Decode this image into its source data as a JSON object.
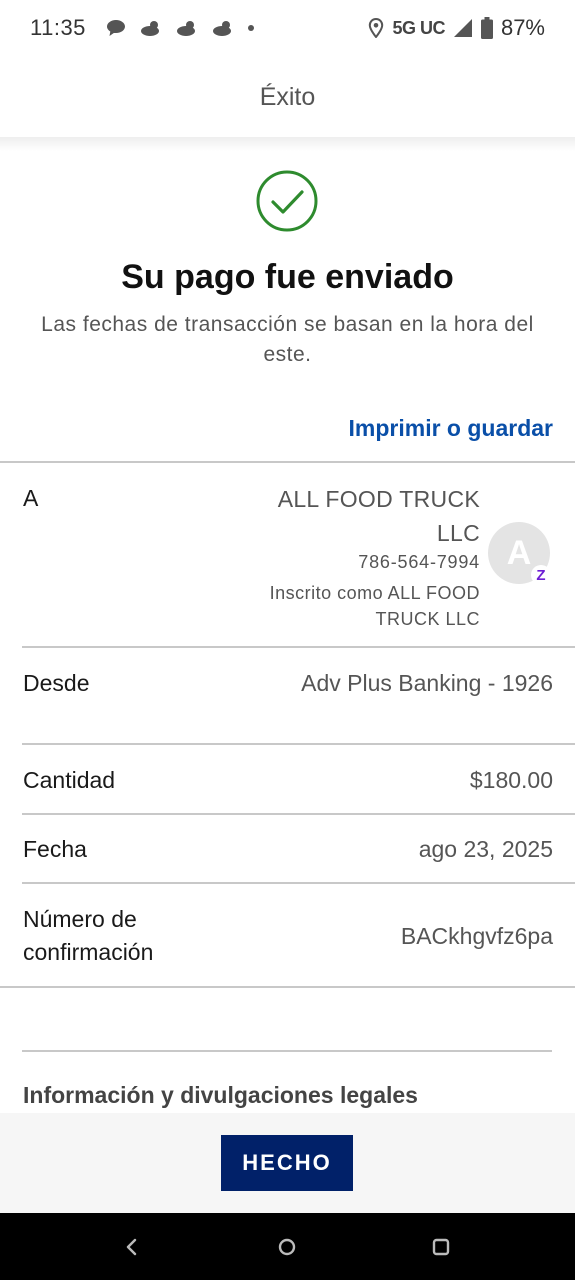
{
  "status_bar": {
    "time": "11:35",
    "network": "5G UC",
    "battery": "87%"
  },
  "header": {
    "title": "Éxito"
  },
  "success": {
    "headline": "Su pago fue enviado",
    "subtext": "Las fechas de transacción se basan en la hora del este.",
    "icon_color": "#2e8b2e"
  },
  "actions": {
    "print_label": "Imprimir o guardar"
  },
  "details": {
    "to": {
      "label": "A",
      "name": "ALL FOOD TRUCK LLC",
      "phone": "786-564-7994",
      "enrolled": "Inscrito como ALL FOOD TRUCK LLC",
      "avatar_letter": "A",
      "badge": "Z"
    },
    "from": {
      "label": "Desde",
      "value": "Adv Plus Banking - 1926"
    },
    "amount": {
      "label": "Cantidad",
      "value": "$180.00"
    },
    "date": {
      "label": "Fecha",
      "value": "ago 23, 2025"
    },
    "confirmation": {
      "label": "Número de confirmación",
      "value": "BACkhgvfz6pa"
    }
  },
  "legal": {
    "title": "Información y divulgaciones legales"
  },
  "footer": {
    "done_label": "HECHO"
  },
  "colors": {
    "accent_link": "#0a4fa8",
    "button_bg": "#012169",
    "zelle": "#6d1ed4"
  }
}
